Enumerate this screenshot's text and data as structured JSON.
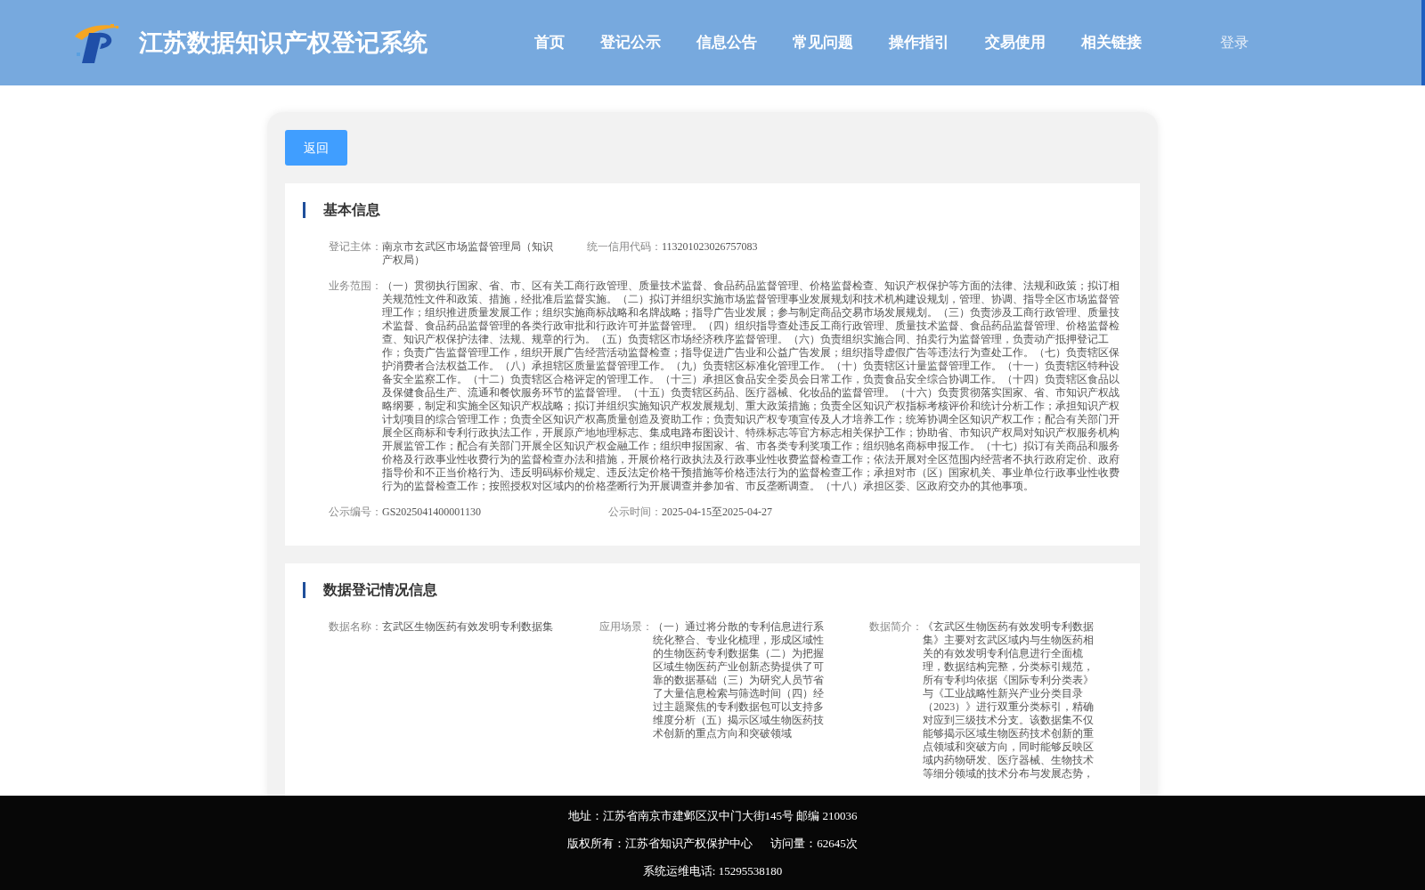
{
  "header": {
    "title": "江苏数据知识产权登记系统",
    "nav": [
      "首页",
      "登记公示",
      "信息公告",
      "常见问题",
      "操作指引",
      "交易使用",
      "相关链接"
    ],
    "login": "登录"
  },
  "back_button": "返回",
  "sections": [
    {
      "title": "基本信息",
      "rows": [
        [
          {
            "label": "登记主体：",
            "value": "南京市玄武区市场监督管理局（知识产权局）"
          },
          {
            "label": "统一信用代码：",
            "value": "113201023026757083"
          }
        ],
        [
          {
            "label": "业务范围：",
            "value": "（一）贯彻执行国家、省、市、区有关工商行政管理、质量技术监督、食品药品监督管理、价格监督检查、知识产权保护等方面的法律、法规和政策；拟订相关规范性文件和政策、措施，经批准后监督实施。（二）拟订并组织实施市场监督管理事业发展规划和技术机构建设规划，管理、协调、指导全区市场监督管理工作；组织推进质量发展工作；组织实施商标战略和名牌战略；指导广告业发展；参与制定商品交易市场发展规划。（三）负责涉及工商行政管理、质量技术监督、食品药品监督管理的各类行政审批和行政许可并监督管理。（四）组织指导查处违反工商行政管理、质量技术监督、食品药品监督管理、价格监督检查、知识产权保护法律、法规、规章的行为。（五）负责辖区市场经济秩序监督管理。（六）负责组织实施合同、拍卖行为监督管理，负责动产抵押登记工作；负责广告监督管理工作，组织开展广告经营活动监督检查；指导促进广告业和公益广告发展；组织指导虚假广告等违法行为查处工作。（七）负责辖区保护消费者合法权益工作。（八）承担辖区质量监督管理工作。（九）负责辖区标准化管理工作。（十）负责辖区计量监督管理工作。（十一）负责辖区特种设备安全监察工作。（十二）负责辖区合格评定的管理工作。（十三）承担区食品安全委员会日常工作，负责食品安全综合协调工作。（十四）负责辖区食品以及保健食品生产、流通和餐饮服务环节的监督管理。（十五）负责辖区药品、医疗器械、化妆品的监督管理。（十六）负责贯彻落实国家、省、市知识产权战略纲要，制定和实施全区知识产权战略；拟订并组织实施知识产权发展规划、重大政策措施；负责全区知识产权指标考核评价和统计分析工作；承担知识产权计划项目的综合管理工作；负责全区知识产权高质量创造及资助工作；负责知识产权专项宣传及人才培养工作；统筹协调全区知识产权工作；配合有关部门开展全区商标和专利行政执法工作，开展原产地地理标志、集成电路布图设计、特殊标志等官方标志相关保护工作；协助省、市知识产权局对知识产权服务机构开展监管工作；配合有关部门开展全区知识产权金融工作；组织申报国家、省、市各类专利奖项工作；组织驰名商标申报工作。（十七）拟订有关商品和服务价格及行政事业性收费行为的监督检查办法和措施，开展价格行政执法及行政事业性收费监督检查工作；依法开展对全区范围内经营者不执行政府定价、政府指导价和不正当价格行为、违反明码标价规定、违反法定价格干预措施等价格违法行为的监督检查工作；承担对市（区）国家机关、事业单位行政事业性收费行为的监督检查工作；按照授权对区域内的价格垄断行为开展调查并参加省、市反垄断调查。（十八）承担区委、区政府交办的其他事项。"
          }
        ],
        [
          {
            "label": "公示编号：",
            "value": "GS2025041400001130"
          },
          {
            "label": "公示时间：",
            "value": "2025-04-15至2025-04-27"
          }
        ]
      ]
    },
    {
      "title": "数据登记情况信息",
      "rows": [
        [
          {
            "label": "数据名称：",
            "value": "玄武区生物医药有效发明专利数据集"
          },
          {
            "label": "应用场景：",
            "value": "（一）通过将分散的专利信息进行系统化整合、专业化梳理，形成区域性的生物医药专利数据集（二）为把握区域生物医药产业创新态势提供了可靠的数据基础（三）为研究人员节省了大量信息检索与筛选时间（四）经过主题聚焦的专利数据包可以支持多维度分析（五）揭示区域生物医药技术创新的重点方向和突破领域"
          },
          {
            "label": "数据简介：",
            "value": "《玄武区生物医药有效发明专利数据集》主要对玄武区域内与生物医药相关的有效发明专利信息进行全面梳理，数据结构完整，分类标引规范，所有专利均依据《国际专利分类表》与《工业战略性新兴产业分类目录（2023）》进行双重分类标引，精确对应到三级技术分支。该数据集不仅能够揭示区域生物医药技术创新的重点领域和突破方向，同时能够反映区域内药物研发、医疗器械、生物技术等细分领域的技术分布与发展态势，"
          }
        ]
      ]
    }
  ],
  "footer": {
    "lines": [
      [
        "地址：江苏省南京市建邺区汉中门大街145号 邮编 210036"
      ],
      [
        "版权所有：江苏省知识产权保护中心",
        "访问量：62645次"
      ],
      [
        "系统运维电话: 15295538180"
      ]
    ]
  }
}
